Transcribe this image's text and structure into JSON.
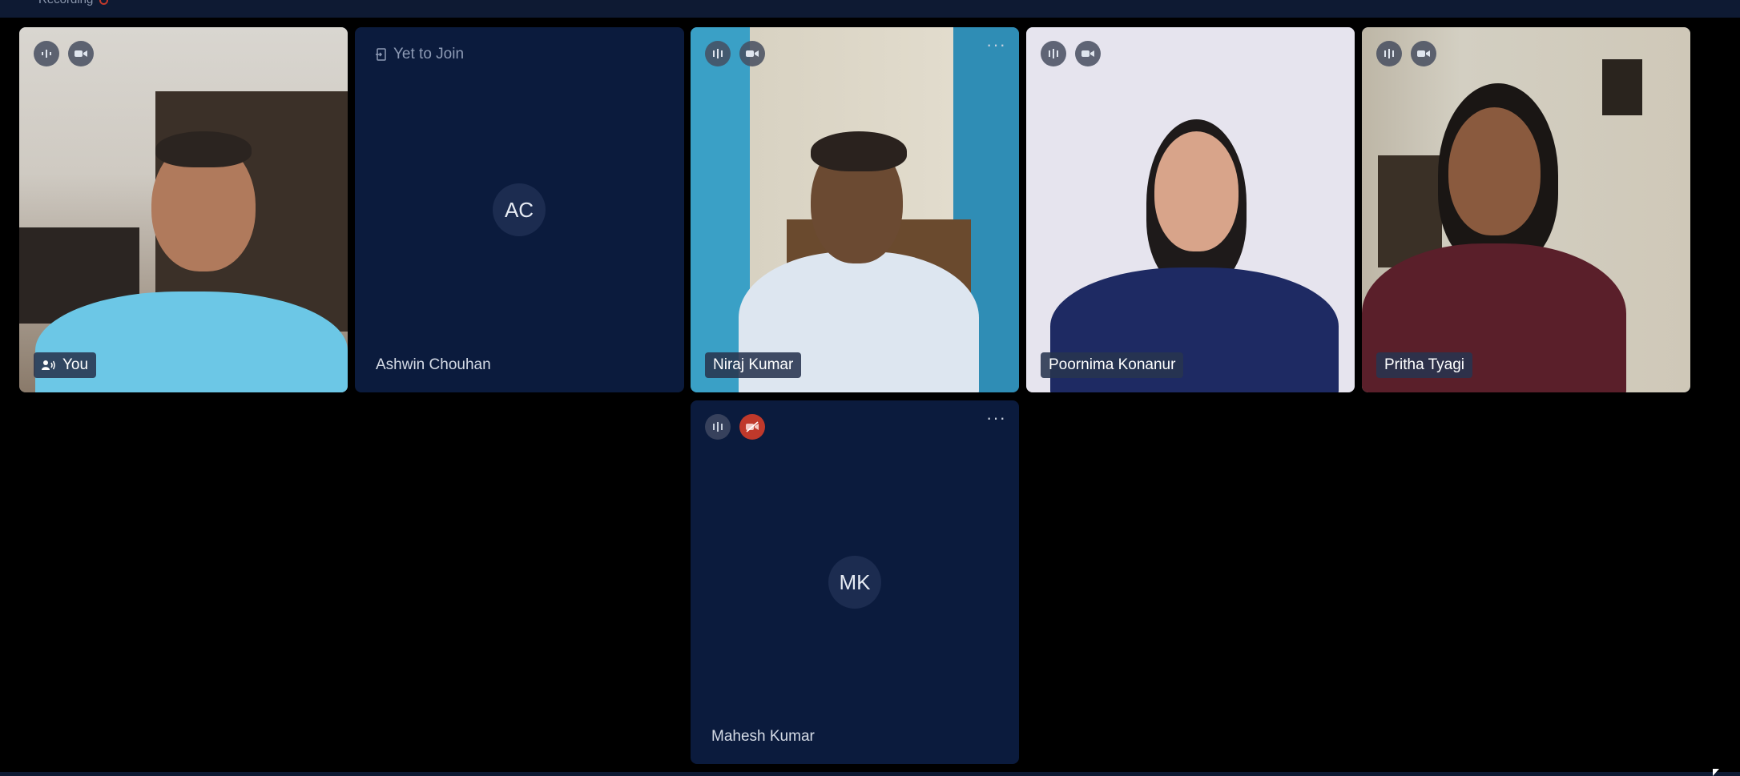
{
  "topbar": {
    "recording_label": "Recording"
  },
  "participants": [
    {
      "id": "you",
      "name": "You",
      "initials": "",
      "status": ""
    },
    {
      "id": "ashwin",
      "name": "Ashwin Chouhan",
      "initials": "AC",
      "status": "Yet to Join"
    },
    {
      "id": "niraj",
      "name": "Niraj Kumar",
      "initials": "",
      "status": ""
    },
    {
      "id": "poornima",
      "name": "Poornima Konanur",
      "initials": "",
      "status": ""
    },
    {
      "id": "pritha",
      "name": "Pritha Tyagi",
      "initials": "",
      "status": ""
    },
    {
      "id": "mahesh",
      "name": "Mahesh Kumar",
      "initials": "MK",
      "status": ""
    }
  ],
  "more_glyph": "···",
  "colors": {
    "tile_bg": "#0b1b3d",
    "topbar_bg": "#0e1a33",
    "muted_red": "#c0392b"
  }
}
